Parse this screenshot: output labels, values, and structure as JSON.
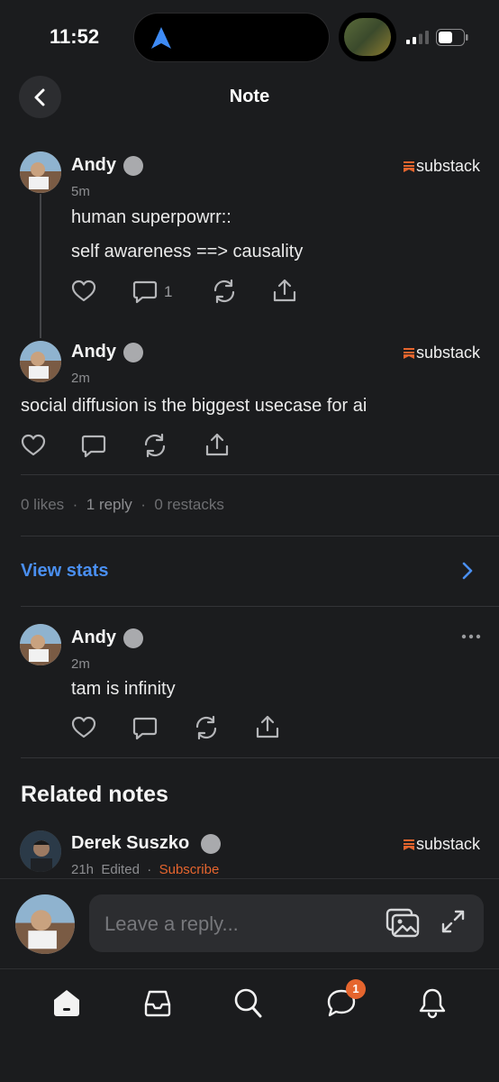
{
  "status_bar": {
    "time": "11:52"
  },
  "header": {
    "title": "Note"
  },
  "notes": [
    {
      "author": "Andy",
      "age": "5m",
      "publication": "substack",
      "lines": [
        "human superpowrr::",
        "self awareness ==> causality"
      ],
      "reply_count": "1"
    },
    {
      "author": "Andy",
      "age": "2m",
      "publication": "substack",
      "lines": [
        "social diffusion is the biggest usecase for ai"
      ]
    }
  ],
  "stats": {
    "likes": "0 likes",
    "replies": "1 reply",
    "restacks": "0 restacks",
    "separator": "·"
  },
  "view_stats_label": "View stats",
  "reply_note": {
    "author": "Andy",
    "age": "2m",
    "text": "tam is infinity"
  },
  "related": {
    "heading": "Related notes",
    "first": {
      "author": "Derek Suszko",
      "age": "21h",
      "edited": "Edited",
      "separator": "·",
      "subscribe": "Subscribe",
      "publication": "substack"
    }
  },
  "reply_box": {
    "placeholder": "Leave a reply..."
  },
  "tabbar": {
    "messages_badge": "1"
  },
  "colors": {
    "accent_blue": "#4a8ff0",
    "brand_orange": "#e5652e",
    "background": "#1b1c1e"
  },
  "icons": [
    "navigation-arrow-icon",
    "signal-icon",
    "battery-icon",
    "back-chevron-icon",
    "heart-icon",
    "comment-icon",
    "restack-icon",
    "share-icon",
    "chevron-right-icon",
    "more-icon",
    "image-icon",
    "expand-icon",
    "home-icon",
    "inbox-icon",
    "search-icon",
    "chat-icon",
    "bell-icon"
  ]
}
